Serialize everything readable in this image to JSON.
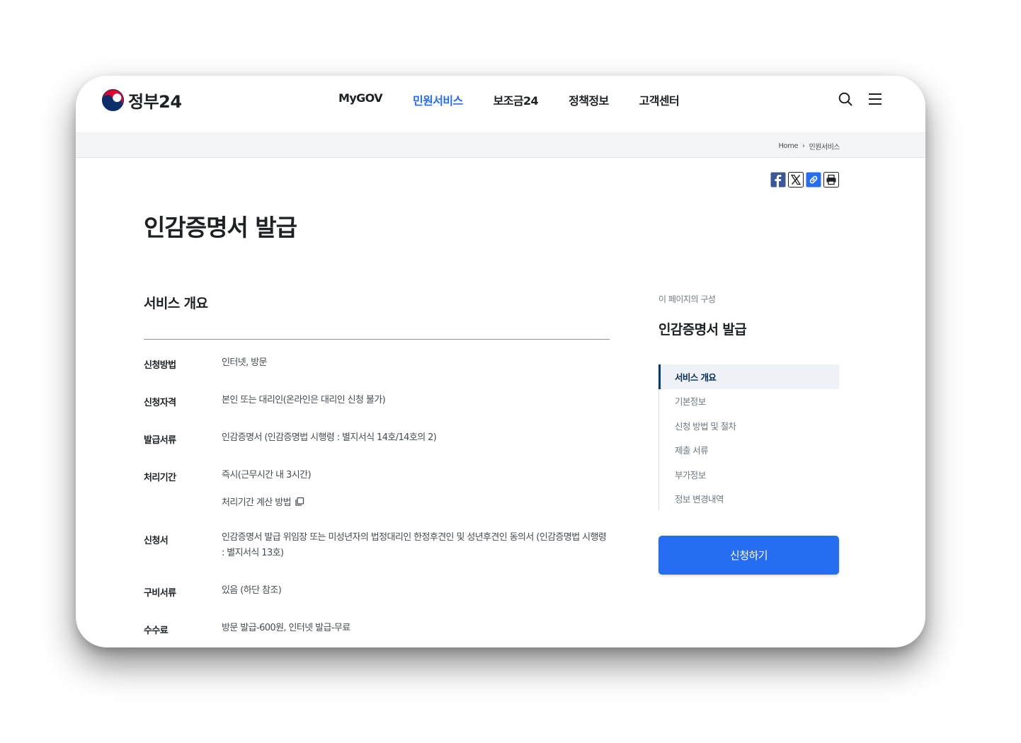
{
  "header": {
    "logo_text": "정부24",
    "nav": [
      {
        "label": "MyGOV",
        "active": false
      },
      {
        "label": "민원서비스",
        "active": true
      },
      {
        "label": "보조금24",
        "active": false
      },
      {
        "label": "정책정보",
        "active": false
      },
      {
        "label": "고객센터",
        "active": false
      }
    ],
    "icons": [
      "search-icon",
      "menu-icon"
    ]
  },
  "breadcrumb": {
    "home": "Home",
    "current": "민원서비스"
  },
  "share": [
    "facebook-icon",
    "x-icon",
    "link-icon",
    "print-icon"
  ],
  "page_title": "인감증명서 발급",
  "overview": {
    "title": "서비스 개요",
    "rows": [
      {
        "label": "신청방법",
        "value": "인터넷, 방문"
      },
      {
        "label": "신청자격",
        "value": "본인 또는 대리인(온라인은 대리인 신청 불가)"
      },
      {
        "label": "발급서류",
        "value": "인감증명서 (인감증명법 시행령 : 별지서식 14호/14호의 2)"
      },
      {
        "label": "처리기간",
        "value": "즉시(근무시간 내 3시간)",
        "link": "처리기간 계산 방법"
      },
      {
        "label": "신청서",
        "value": "인감증명서 발급 위임장 또는 미성년자의 법정대리인 한정후견인 및 성년후견인 동의서 (인감증명법 시행령 : 별지서식 13호)"
      },
      {
        "label": "구비서류",
        "value": "있음 (하단 참조)"
      },
      {
        "label": "수수료",
        "value": "방문 발급-600원, 인터넷 발급-무료"
      }
    ]
  },
  "toc": {
    "caption": "이 페이지의 구성",
    "title": "인감증명서 발급",
    "items": [
      {
        "label": "서비스 개요",
        "active": true
      },
      {
        "label": "기본정보",
        "active": false
      },
      {
        "label": "신청 방법 및 절차",
        "active": false
      },
      {
        "label": "제출 서류",
        "active": false
      },
      {
        "label": "부가정보",
        "active": false
      },
      {
        "label": "정보 변경내역",
        "active": false
      }
    ]
  },
  "apply_button": "신청하기",
  "colors": {
    "accent": "#256ef4",
    "toc_active_bar": "#063a74",
    "toc_active_bg": "#eef2f7",
    "breadcrumb_bar": "#f4f5f6"
  }
}
